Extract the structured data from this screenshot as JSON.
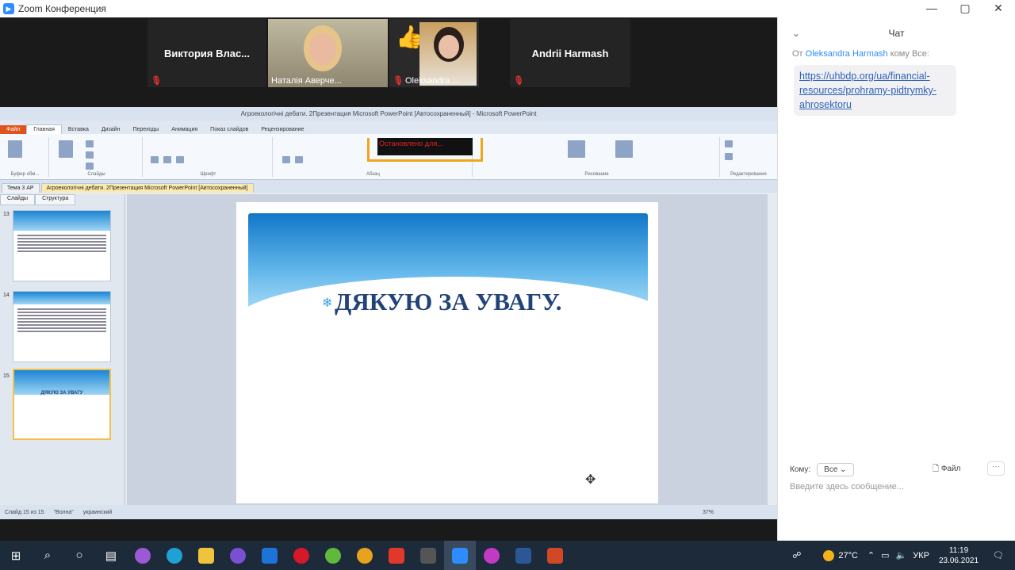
{
  "window": {
    "title": "Zoom Конференция",
    "controls": [
      "—",
      "▢",
      "✕"
    ]
  },
  "participants": [
    {
      "name": "Виктория  Влас...",
      "video": false,
      "muted": true
    },
    {
      "name": "Наталія Аверче...",
      "video": true,
      "muted": false
    },
    {
      "name": "Oleksandra ...",
      "video": true,
      "muted": true,
      "reaction": "👍"
    },
    {
      "name": "Andrii Harmash",
      "video": false,
      "muted": true
    }
  ],
  "ppt": {
    "title": "Агроекологічні дебати. 2Презентация Microsoft PowerPoint [Автосохраненный] - Microsoft PowerPoint",
    "tabs": [
      "Файл",
      "Главная",
      "Вставка",
      "Дизайн",
      "Переходы",
      "Анимация",
      "Показ слайдов",
      "Рецензирование"
    ],
    "overlay_text": "Остановлено для...",
    "groups": [
      "Буфер обм...",
      "Слайды",
      "Шрифт",
      "Абзац",
      "Рисование",
      "Редактирование"
    ],
    "doc_tabs": [
      "Тема 3 АР",
      "Агроекологічні дебати. 2Презентация Microsoft PowerPoint [Автосохраненный]"
    ],
    "pane_tabs": [
      "Слайды",
      "Структура"
    ],
    "slide_numbers": [
      "13",
      "14",
      "15"
    ],
    "thumb_title": "ДЯКУЮ ЗА УВАГУ",
    "slide_title": "ДЯКУЮ ЗА УВАГУ.",
    "status": {
      "slide": "Слайд 15 из 15",
      "theme": "\"Волна\"",
      "lang": "украинский",
      "zoom": "37%"
    }
  },
  "chat": {
    "header": "Чат",
    "from_label": "От",
    "sender": "Oleksandra Harmash",
    "to_all": "кому Все:",
    "link": "https://uhbdp.org/ua/financial-resources/prohramy-pidtrymky-ahrosektoru",
    "to_label": "Кому:",
    "to_value": "Все",
    "file_label": "Файл",
    "more": "···",
    "placeholder": "Введите здесь сообщение..."
  },
  "taskbar": {
    "temperature": "27°C",
    "lang": "УКР",
    "time": "11:19",
    "date": "23.06.2021"
  },
  "colors": {
    "zoom_blue": "#2d8cff",
    "ppt_file_tab": "#e0531c",
    "slide_title": "#22437a",
    "highlight": "#f0a61a"
  }
}
